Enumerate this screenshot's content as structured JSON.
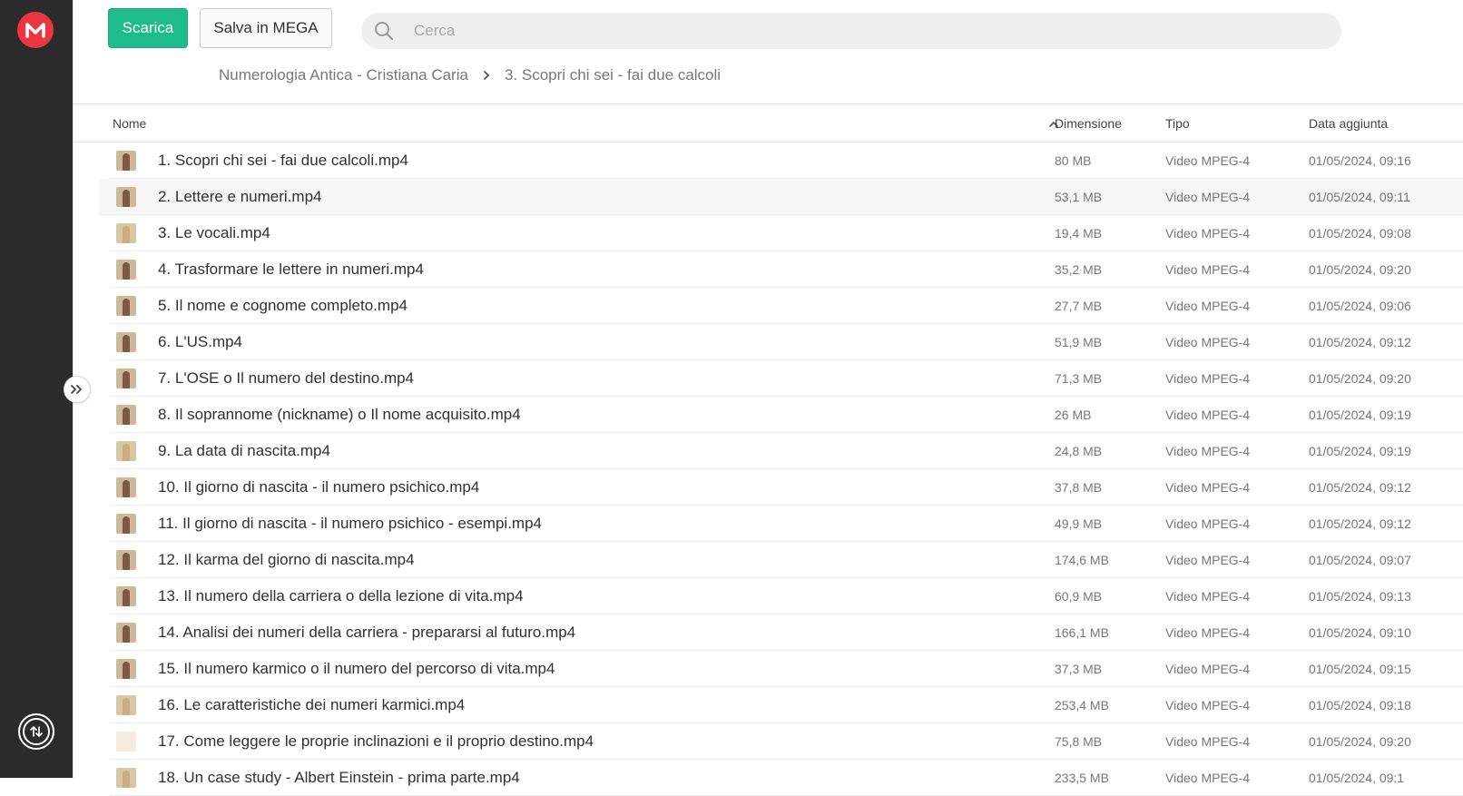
{
  "toolbar": {
    "download_label": "Scarica",
    "save_label": "Salva in MEGA"
  },
  "search": {
    "placeholder": "Cerca",
    "icon": "search-icon"
  },
  "breadcrumb": {
    "items": [
      "Numerologia Antica - Cristiana Caria",
      "3. Scopri chi sei - fai due calcoli"
    ]
  },
  "table": {
    "columns": {
      "name": "Nome",
      "size": "Dimensione",
      "type": "Tipo",
      "date": "Data aggiunta"
    },
    "rows": [
      {
        "name": "1. Scopri chi sei - fai due calcoli.mp4",
        "size": "80 MB",
        "type": "Video MPEG-4",
        "date": "01/05/2024, 09:16"
      },
      {
        "name": "2. Lettere e numeri.mp4",
        "size": "53,1 MB",
        "type": "Video MPEG-4",
        "date": "01/05/2024, 09:11"
      },
      {
        "name": "3. Le vocali.mp4",
        "size": "19,4 MB",
        "type": "Video MPEG-4",
        "date": "01/05/2024, 09:08"
      },
      {
        "name": "4. Trasformare le lettere in numeri.mp4",
        "size": "35,2 MB",
        "type": "Video MPEG-4",
        "date": "01/05/2024, 09:20"
      },
      {
        "name": "5. Il nome e cognome completo.mp4",
        "size": "27,7 MB",
        "type": "Video MPEG-4",
        "date": "01/05/2024, 09:06"
      },
      {
        "name": "6. L'US.mp4",
        "size": "51,9 MB",
        "type": "Video MPEG-4",
        "date": "01/05/2024, 09:12"
      },
      {
        "name": "7. L'OSE o Il numero del destino.mp4",
        "size": "71,3 MB",
        "type": "Video MPEG-4",
        "date": "01/05/2024, 09:20"
      },
      {
        "name": "8. Il soprannome (nickname) o Il nome acquisito.mp4",
        "size": "26 MB",
        "type": "Video MPEG-4",
        "date": "01/05/2024, 09:19"
      },
      {
        "name": "9. La data di nascita.mp4",
        "size": "24,8 MB",
        "type": "Video MPEG-4",
        "date": "01/05/2024, 09:19"
      },
      {
        "name": "10. Il giorno di nascita - il numero psichico.mp4",
        "size": "37,8 MB",
        "type": "Video MPEG-4",
        "date": "01/05/2024, 09:12"
      },
      {
        "name": "11. Il giorno di nascita - il numero psichico - esempi.mp4",
        "size": "49,9 MB",
        "type": "Video MPEG-4",
        "date": "01/05/2024, 09:12"
      },
      {
        "name": "12. Il karma del giorno di nascita.mp4",
        "size": "174,6 MB",
        "type": "Video MPEG-4",
        "date": "01/05/2024, 09:07"
      },
      {
        "name": "13. Il numero della carriera o della lezione di vita.mp4",
        "size": "60,9 MB",
        "type": "Video MPEG-4",
        "date": "01/05/2024, 09:13"
      },
      {
        "name": "14. Analisi dei numeri della carriera - prepararsi al futuro.mp4",
        "size": "166,1 MB",
        "type": "Video MPEG-4",
        "date": "01/05/2024, 09:10"
      },
      {
        "name": "15. Il numero karmico o il numero del percorso di vita.mp4",
        "size": "37,3 MB",
        "type": "Video MPEG-4",
        "date": "01/05/2024, 09:15"
      },
      {
        "name": "16. Le caratteristiche dei numeri karmici.mp4",
        "size": "253,4 MB",
        "type": "Video MPEG-4",
        "date": "01/05/2024, 09:18"
      },
      {
        "name": "17. Come leggere le proprie inclinazioni e il proprio destino.mp4",
        "size": "75,8 MB",
        "type": "Video MPEG-4",
        "date": "01/05/2024, 09:20"
      },
      {
        "name": "18. Un case study - Albert Einstein - prima parte.mp4",
        "size": "233,5 MB",
        "type": "Video MPEG-4",
        "date": "01/05/2024, 09:1"
      }
    ]
  },
  "colors": {
    "accent_green": "#1fbc8b",
    "brand_red": "#e9363f",
    "sidebar": "#2b2b2b"
  }
}
